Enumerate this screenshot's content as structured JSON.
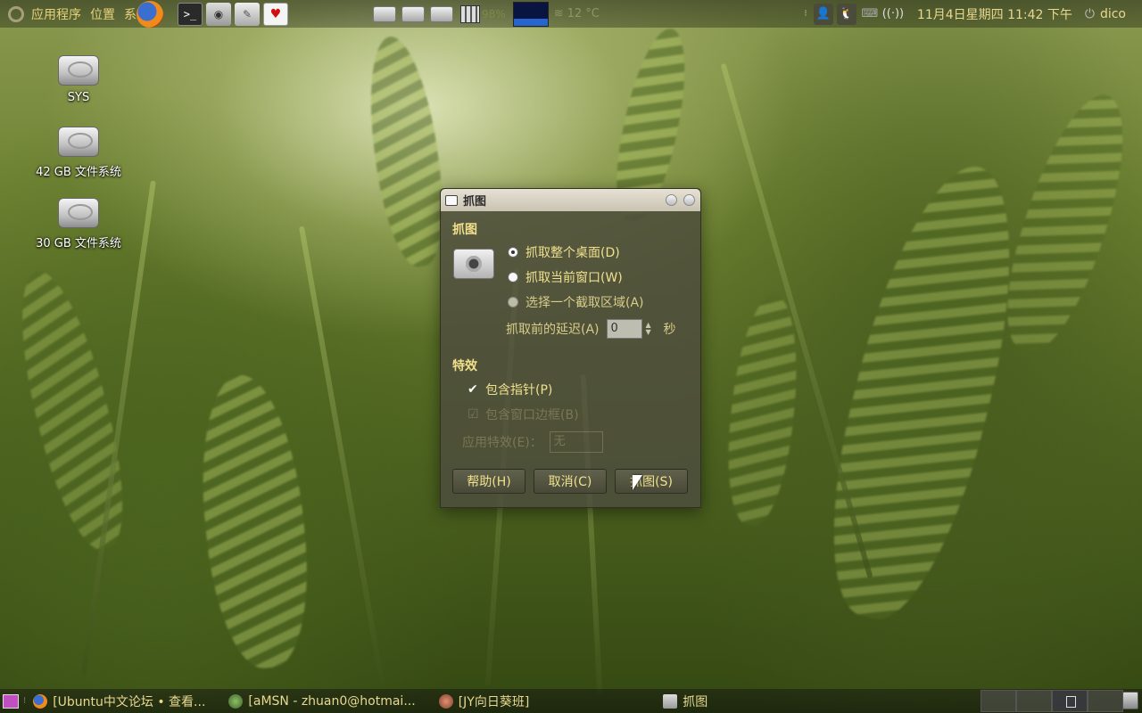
{
  "top_panel": {
    "menus": [
      "应用程序",
      "位置",
      "系统"
    ],
    "cpu_label": "98%",
    "weather_temp": "12 °C",
    "clock": "11月4日星期四 11:42 下午",
    "username": "dico",
    "icons": {
      "distributor": "ubuntu-logo",
      "firefox": "firefox-icon",
      "terminal": ">_",
      "camera": "camera-icon",
      "editor": "text-editor-icon",
      "heart": "♥",
      "weather": "≋",
      "user": "user-icon",
      "qq": "qq-icon",
      "keyboard": "⌨",
      "wifi": "wifi-icon",
      "power": "⏻"
    }
  },
  "desktop_icons": [
    {
      "label": "SYS"
    },
    {
      "label": "42 GB 文件系统"
    },
    {
      "label": "30 GB 文件系统"
    }
  ],
  "dialog": {
    "title": "抓图",
    "section_capture": "抓图",
    "radio_options": [
      {
        "label": "抓取整个桌面(D)",
        "checked": true
      },
      {
        "label": "抓取当前窗口(W)",
        "checked": false
      },
      {
        "label": "选择一个截取区域(A)",
        "checked": false
      }
    ],
    "delay_label": "抓取前的延迟(A)",
    "delay_value": "0",
    "delay_unit": "秒",
    "section_effects": "特效",
    "include_pointer": "包含指针(P)",
    "include_border": "包含窗口边框(B)",
    "apply_effect_label": "应用特效(E)：",
    "apply_effect_value": "无",
    "buttons": {
      "help": "帮助(H)",
      "cancel": "取消(C)",
      "capture": "抓图(S)"
    }
  },
  "bottom_panel": {
    "tasks": [
      {
        "label": "[Ubuntu中文论坛 • 查看...",
        "icon": "firefox-icon"
      },
      {
        "label": "[aMSN - zhuan0@hotmai...",
        "icon": "amsn-icon"
      },
      {
        "label": "[JY向日葵班]",
        "icon": "chat-icon"
      },
      {
        "label": "抓图",
        "icon": "camera-icon"
      }
    ],
    "workspaces": 4,
    "active_workspace": 3
  }
}
